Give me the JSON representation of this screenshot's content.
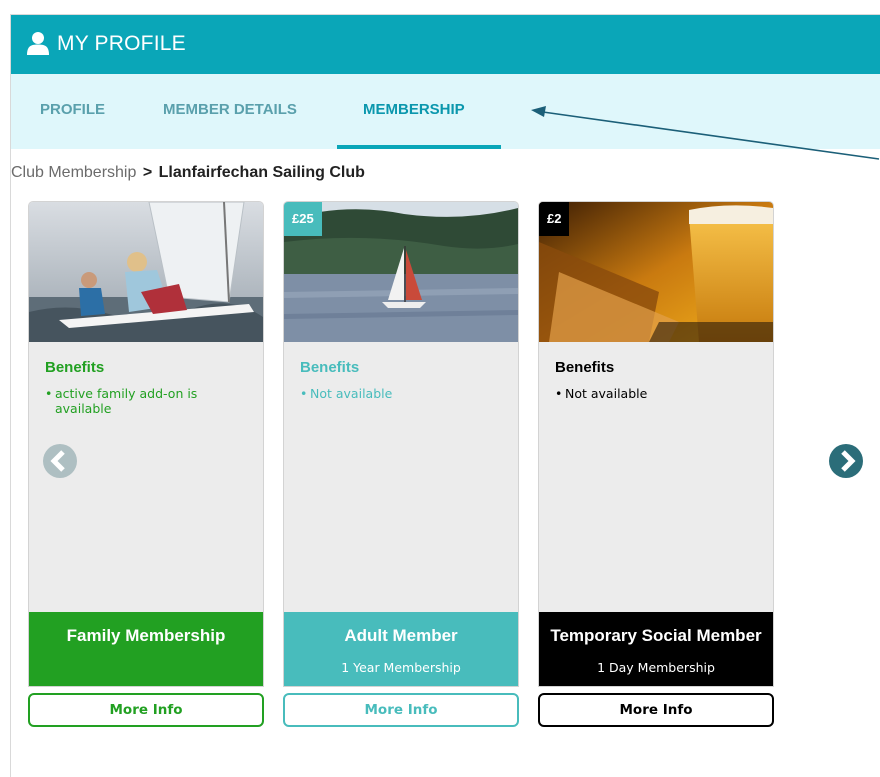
{
  "header": {
    "title": "MY PROFILE",
    "icon": "user-icon",
    "background": "#0aa6b8"
  },
  "tabs": [
    {
      "label": "PROFILE",
      "active": false
    },
    {
      "label": "MEMBER DETAILS",
      "active": false
    },
    {
      "label": "MEMBERSHIP",
      "active": true
    }
  ],
  "breadcrumb": {
    "parent": "Club Membership",
    "separator": ">",
    "current": "Llanfairfechan Sailing Club"
  },
  "carousel": {
    "prev_icon": "chevron-left-icon",
    "next_icon": "chevron-right-icon"
  },
  "cards": [
    {
      "name": "Family Membership",
      "duration": "",
      "price": "",
      "benefits_title": "Benefits",
      "benefits": [
        "active family add-on is available"
      ],
      "button_label": "More Info",
      "color": "#22a022",
      "photo": "sailing-dinghy-photo"
    },
    {
      "name": "Adult Member",
      "duration": "1 Year Membership",
      "price": "£25",
      "benefits_title": "Benefits",
      "benefits": [
        "Not available"
      ],
      "button_label": "More Info",
      "color": "#48bcbc",
      "photo": "sailboat-lake-photo"
    },
    {
      "name": "Temporary Social Member",
      "duration": "1 Day Membership",
      "price": "£2",
      "benefits_title": "Benefits",
      "benefits": [
        "Not available"
      ],
      "button_label": "More Info",
      "color": "#000000",
      "photo": "beer-glass-photo"
    }
  ]
}
